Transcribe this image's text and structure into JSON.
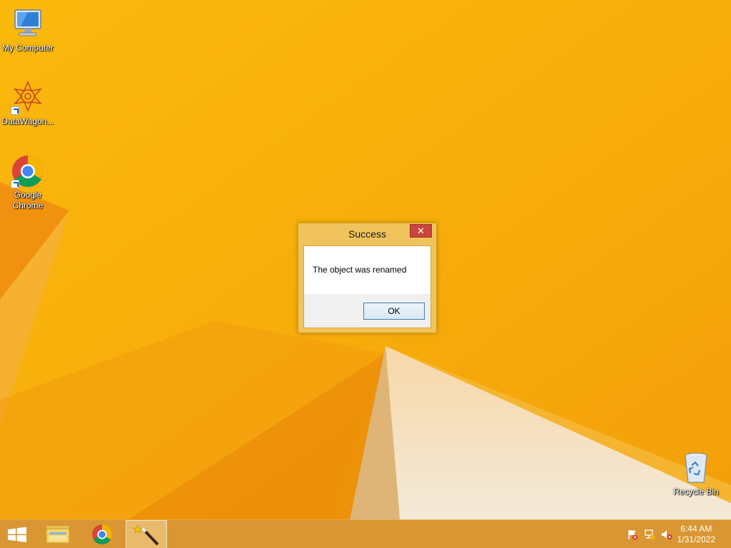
{
  "desktop": {
    "icons": [
      {
        "label": "My Computer",
        "icon": "computer-icon"
      },
      {
        "label": "DataWagon...",
        "icon": "datawagon-icon"
      },
      {
        "label": "Google Chrome",
        "icon": "chrome-icon"
      },
      {
        "label": "Recycle Bin",
        "icon": "recycle-bin-icon"
      }
    ]
  },
  "dialog": {
    "title": "Success",
    "close_symbol": "✕",
    "message": "The object was renamed",
    "ok_label": "OK"
  },
  "taskbar": {
    "items": [
      {
        "name": "start",
        "icon": "windows-logo-icon"
      },
      {
        "name": "file-explorer",
        "icon": "folder-icon"
      },
      {
        "name": "chrome",
        "icon": "chrome-icon"
      },
      {
        "name": "active-app",
        "icon": "magic-wand-icon",
        "active": true
      }
    ],
    "tray": {
      "icons": [
        "action-center-flag-icon",
        "network-icon",
        "volume-muted-icon"
      ],
      "time": "6:44 AM",
      "date": "1/31/2022"
    }
  },
  "colors": {
    "wallpaper": "#f8ae0a",
    "dialog_frame": "#f1c35c",
    "close_button": "#c7463d",
    "ok_border": "#3c7fb1"
  }
}
